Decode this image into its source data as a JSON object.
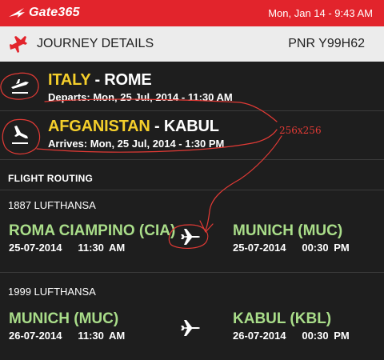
{
  "app": {
    "name": "Gate365",
    "datetime": "Mon, Jan 14 - 9:43 AM",
    "accent": "#e2242c"
  },
  "header": {
    "icon": "airplane-icon",
    "title": "JOURNEY DETAILS",
    "pnr": "PNR Y99H62"
  },
  "legs": [
    {
      "icon": "takeoff-icon",
      "country": "ITALY",
      "separator": " - ",
      "city": "ROME",
      "detail": "Departs: Mon, 25 Jul, 2014 - 11:30 AM"
    },
    {
      "icon": "landing-icon",
      "country": "AFGANISTAN",
      "separator": " - ",
      "city": "KABUL",
      "detail": "Arrives: Mon, 25 Jul, 2014 - 1:30 PM"
    }
  ],
  "routing": {
    "heading": "FLIGHT ROUTING",
    "segments": [
      {
        "carrier": "1887 LUFTHANSA",
        "from": {
          "airport": "ROMA CIAMPINO (CIA)",
          "date": "25-07-2014",
          "time": "11:30 AM"
        },
        "to": {
          "airport": "MUNICH (MUC)",
          "date": "25-07-2014",
          "time": "00:30 PM"
        }
      },
      {
        "carrier": "1999 LUFTHANSA",
        "from": {
          "airport": "MUNICH (MUC)",
          "date": "26-07-2014",
          "time": "11:30 AM"
        },
        "to": {
          "airport": "KABUL (KBL)",
          "date": "26-07-2014",
          "time": "00:30 PM"
        }
      }
    ]
  },
  "annotation": {
    "label": "256x256",
    "color": "#e23a35"
  },
  "colors": {
    "country": "#f5cf2b",
    "airport": "#a9dd89",
    "background": "#1e1e1e",
    "header_bar": "#ececec"
  }
}
